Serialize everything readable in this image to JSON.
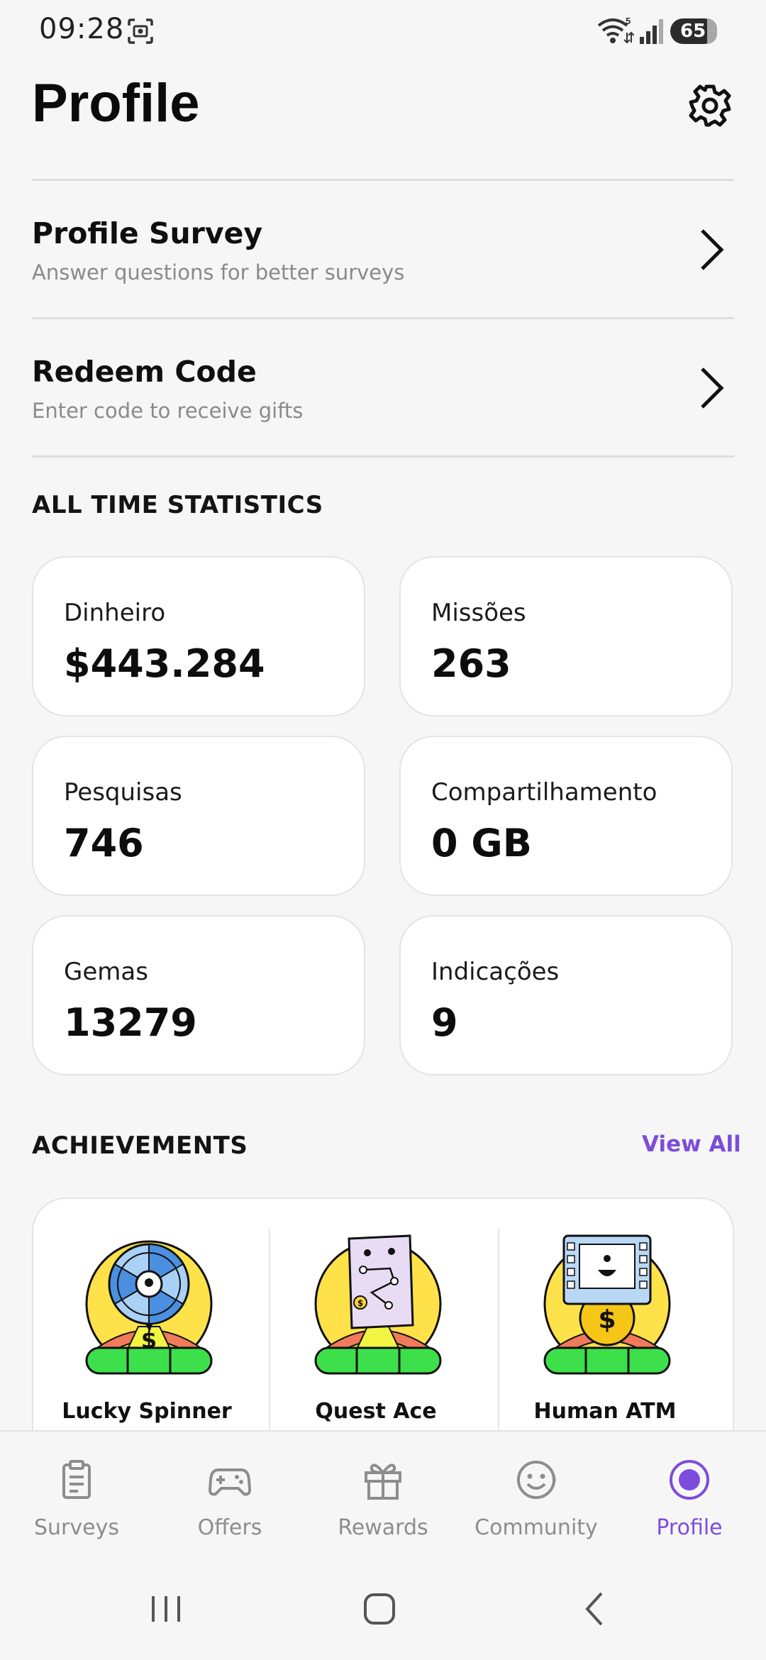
{
  "status_bar": {
    "time": "09:28",
    "battery": "65",
    "wifi_badge": "5"
  },
  "header": {
    "title": "Profile"
  },
  "menu": [
    {
      "title": "Profile Survey",
      "subtitle": "Answer questions for better surveys"
    },
    {
      "title": "Redeem Code",
      "subtitle": "Enter code to receive gifts"
    }
  ],
  "statistics": {
    "heading": "ALL TIME STATISTICS",
    "items": [
      {
        "label": "Dinheiro",
        "value": "$443.284"
      },
      {
        "label": "Missões",
        "value": "263"
      },
      {
        "label": "Pesquisas",
        "value": "746"
      },
      {
        "label": "Compartilhamento",
        "value": "0 GB"
      },
      {
        "label": "Gemas",
        "value": "13279"
      },
      {
        "label": "Indicações",
        "value": "9"
      }
    ]
  },
  "achievements": {
    "heading": "ACHIEVEMENTS",
    "view_all": "View All",
    "items": [
      {
        "name": "Lucky Spinner",
        "icon": "lucky-spinner-badge-icon"
      },
      {
        "name": "Quest Ace",
        "icon": "quest-ace-badge-icon"
      },
      {
        "name": "Human ATM",
        "icon": "human-atm-badge-icon"
      }
    ]
  },
  "bottom_nav": {
    "active": "Profile",
    "items": [
      {
        "label": "Surveys",
        "icon": "clipboard-icon"
      },
      {
        "label": "Offers",
        "icon": "gamepad-icon"
      },
      {
        "label": "Rewards",
        "icon": "gift-icon"
      },
      {
        "label": "Community",
        "icon": "smiley-icon"
      },
      {
        "label": "Profile",
        "icon": "profile-icon"
      }
    ]
  },
  "colors": {
    "accent": "#7c4ddb",
    "background": "#f6f6f7",
    "card": "#ffffff",
    "muted": "#8d8d8d"
  }
}
